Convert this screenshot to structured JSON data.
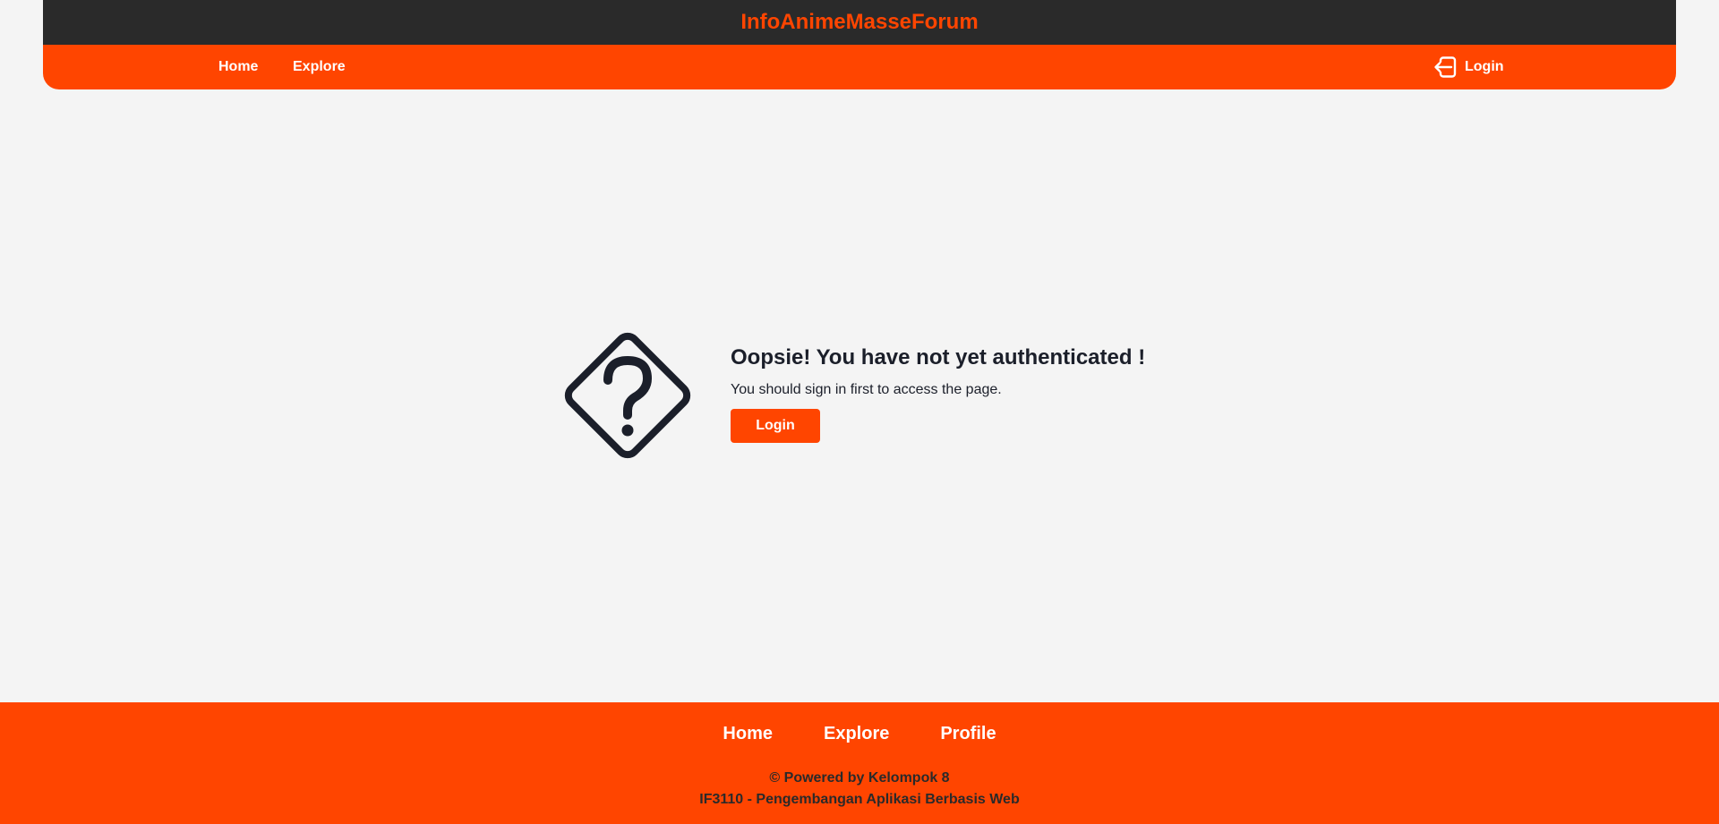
{
  "header": {
    "brand": "InfoAnimeMasseForum",
    "nav": {
      "home": "Home",
      "explore": "Explore",
      "login": "Login"
    },
    "icons": {
      "login": "login-icon"
    }
  },
  "main": {
    "icon": "question-diamond-icon",
    "heading": "Oopsie! You have not yet authenticated !",
    "message": "You should sign in first to access the page.",
    "button_label": "Login"
  },
  "footer": {
    "nav": {
      "home": "Home",
      "explore": "Explore",
      "profile": "Profile"
    },
    "credit_line1": "© Powered by Kelompok 8",
    "credit_line2": "IF3110 - Pengembangan Aplikasi Berbasis Web"
  },
  "colors": {
    "accent": "#ff4500",
    "header_dark": "#2a2a2a",
    "background": "#f4f4f4",
    "text_dark": "#1b1f2a"
  }
}
